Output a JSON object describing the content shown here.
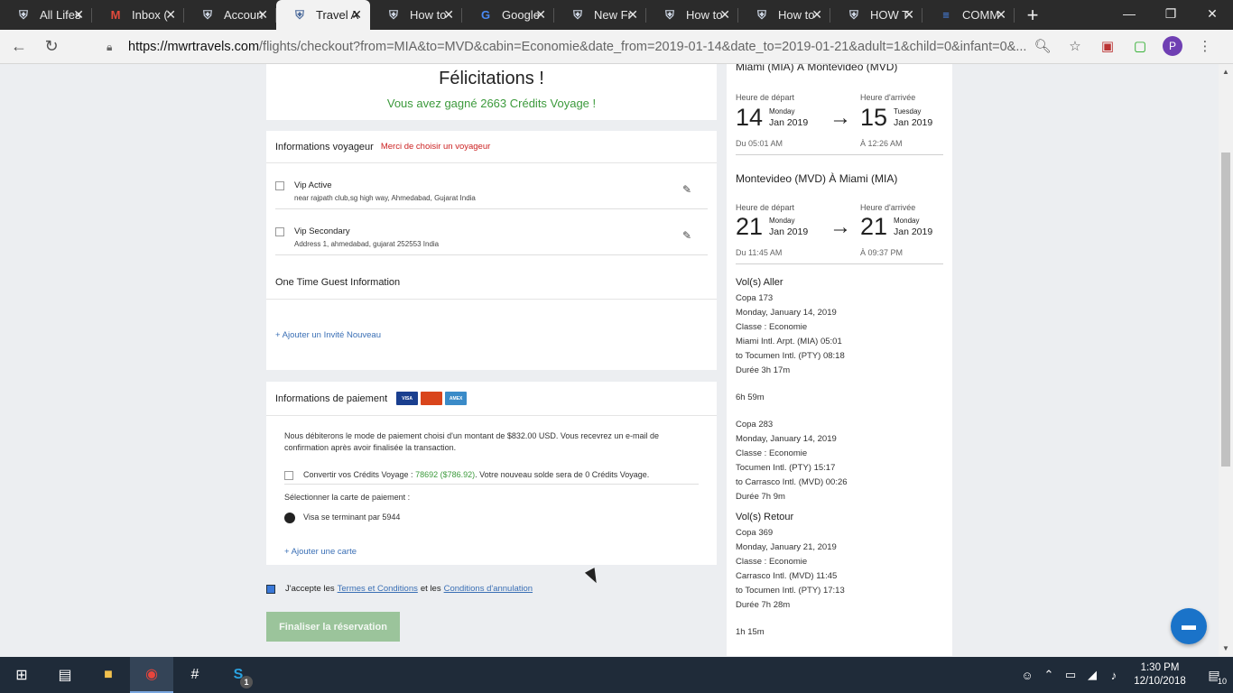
{
  "browser": {
    "tabs": [
      {
        "title": "All Lifes",
        "icon": "shield-icon",
        "active": false
      },
      {
        "title": "Inbox (",
        "icon": "gmail-icon",
        "active": false
      },
      {
        "title": "Accoun",
        "icon": "shield-icon",
        "active": false
      },
      {
        "title": "Travel A",
        "icon": "shield-icon",
        "active": true
      },
      {
        "title": "How to",
        "icon": "shield-icon",
        "active": false
      },
      {
        "title": "Google",
        "icon": "google-translate-icon",
        "active": false
      },
      {
        "title": "New Fr",
        "icon": "shield-icon",
        "active": false
      },
      {
        "title": "How to",
        "icon": "shield-icon",
        "active": false
      },
      {
        "title": "How to",
        "icon": "shield-icon",
        "active": false
      },
      {
        "title": "HOW T",
        "icon": "shield-icon",
        "active": false
      },
      {
        "title": "COMM",
        "icon": "docs-icon",
        "active": false
      }
    ],
    "url_host": "https://mwrtravels.com",
    "url_rest": "/flights/checkout?from=MIA&to=MVD&cabin=Economie&date_from=2019-01-14&date_to=2019-01-21&adult=1&child=0&infant=0&...",
    "avatar_letter": "P"
  },
  "congrats": {
    "title": "Félicitations !",
    "subtitle": "Vous avez gagné 2663 Crédits Voyage !"
  },
  "travelers": {
    "heading": "Informations voyageur",
    "warning": "Merci de choisir un voyageur",
    "items": [
      {
        "name": "Vip Active",
        "address": "near rajpath club,sg high way, Ahmedabad, Gujarat India"
      },
      {
        "name": "Vip Secondary",
        "address": "Address 1, ahmedabad, gujarat 252553 India"
      }
    ],
    "guest_heading": "One Time Guest Information",
    "add_guest": "+ Ajouter un Invité Nouveau"
  },
  "payment": {
    "heading": "Informations de paiement",
    "cards": [
      "VISA",
      "MasterCard",
      "AMEX"
    ],
    "notice": "Nous débiterons le mode de paiement choisi d'un montant de $832.00 USD. Vous recevrez un e-mail de confirmation après avoir finalisée la transaction.",
    "convert_label": "Convertir vos Crédits Voyage :",
    "convert_amount": "78692 ($786.92)",
    "convert_suffix": ". Votre nouveau solde sera de 0 Crédits Voyage.",
    "select_label": "Sélectionner la carte de paiement :",
    "card_option": "Visa se terminant par 5944",
    "add_card": "+ Ajouter une carte"
  },
  "terms": {
    "prefix": "J'accepte les",
    "link1": "Termes et Conditions",
    "middle": "et les",
    "link2": "Conditions d'annulation"
  },
  "finalize_button": "Finaliser la réservation",
  "summary": {
    "outbound": {
      "title": "Miami (MIA) À Montevideo (MVD)",
      "dep_label": "Heure de départ",
      "arr_label": "Heure d'arrivée",
      "dep_day": "14",
      "dep_weekday": "Monday",
      "dep_month": "Jan 2019",
      "dep_time": "Du 05:01 AM",
      "arr_day": "15",
      "arr_weekday": "Tuesday",
      "arr_month": "Jan 2019",
      "arr_time": "À 12:26 AM"
    },
    "return": {
      "title": "Montevideo (MVD) À Miami (MIA)",
      "dep_label": "Heure de départ",
      "arr_label": "Heure d'arrivée",
      "dep_day": "21",
      "dep_weekday": "Monday",
      "dep_month": "Jan 2019",
      "dep_time": "Du 11:45 AM",
      "arr_day": "21",
      "arr_weekday": "Monday",
      "arr_month": "Jan 2019",
      "arr_time": "À 09:37 PM"
    },
    "aller_heading": "Vol(s) Aller",
    "aller_legs": [
      [
        "Copa 173",
        "Monday, January 14, 2019",
        "Classe : Economie",
        "Miami Intl. Arpt. (MIA) 05:01",
        "to Tocumen Intl. (PTY) 08:18",
        "Durée 3h 17m"
      ],
      [
        "6h 59m"
      ],
      [
        "Copa 283",
        "Monday, January 14, 2019",
        "Classe : Economie",
        "Tocumen Intl. (PTY) 15:17",
        "to Carrasco Intl. (MVD) 00:26",
        "Durée 7h 9m"
      ]
    ],
    "retour_heading": "Vol(s) Retour",
    "retour_legs": [
      [
        "Copa 369",
        "Monday, January 21, 2019",
        "Classe : Economie",
        "Carrasco Intl. (MVD) 11:45",
        "to Tocumen Intl. (PTY) 17:13",
        "Durée 7h 28m"
      ],
      [
        "1h 15m"
      ]
    ]
  },
  "taskbar": {
    "time": "1:30 PM",
    "date": "12/10/2018",
    "notifications": "10",
    "skype_badge": "1"
  },
  "colors": {
    "accent_green": "#3c9a3c",
    "warning_red": "#cc2222",
    "link_blue": "#3a6fb5",
    "button_green": "#9bc49b"
  }
}
